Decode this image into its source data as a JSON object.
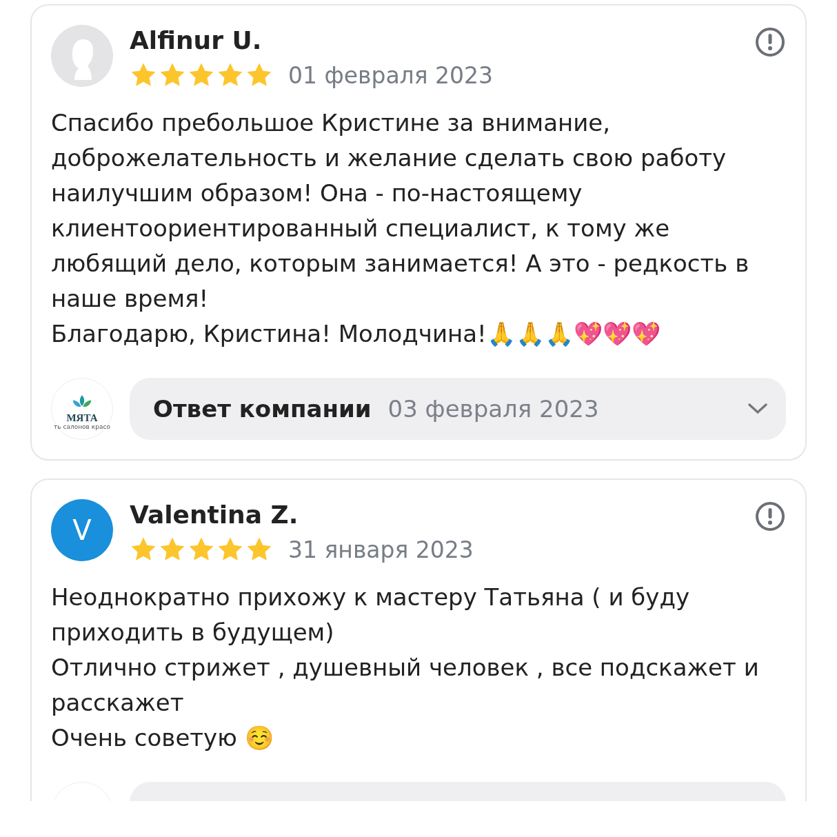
{
  "reviews": [
    {
      "author": "Alfinur U.",
      "avatar": {
        "kind": "silhouette"
      },
      "stars": 5,
      "date": "01 февраля 2023",
      "text": [
        "Спасибо пребольшое Кристине за внимание, доброжелательность и желание сделать свою работу наилучшим образом! Она - по-настоящему клиентоориентированный специалист, к тому же любящий дело, которым занимается! А это - редкость в наше время!",
        "Благодарю, Кристина! Молодчина!🙏🙏🙏💖💖💖"
      ],
      "reply": {
        "kind": "full",
        "logo_name": "МЯТА",
        "logo_tagline": "ть салонов красо",
        "label": "Ответ компании",
        "date": "03 февраля 2023",
        "expanded": false
      }
    },
    {
      "author": "Valentina Z.",
      "avatar": {
        "kind": "letter",
        "letter": "V",
        "color": "#1a8fdc"
      },
      "stars": 5,
      "date": "31 января 2023",
      "text": [
        "Неоднократно прихожу к мастеру Татьяна ( и буду приходить в будущем)",
        "Отлично стрижет , душевный человек , все подскажет и расскажет",
        "Очень советую ☺️"
      ],
      "reply": {
        "kind": "cut_off"
      }
    }
  ]
}
